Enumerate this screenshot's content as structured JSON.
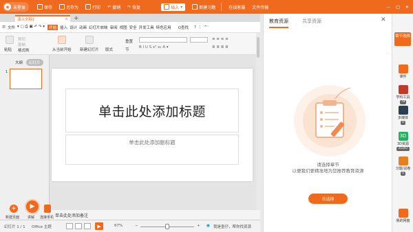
{
  "topbar": {
    "user_label": "未登录",
    "save": "保存",
    "save_as": "另存为",
    "print": "打印",
    "undo": "撤销",
    "redo": "恢复",
    "insert": "插入",
    "new_exercise": "新建习题",
    "online_service": "在线客服",
    "file_transfer": "文件传输"
  },
  "document_tab": {
    "title": "演示文稿1"
  },
  "menu": {
    "file": "文件",
    "items": [
      "开始",
      "插入",
      "设计",
      "动画",
      "幻灯片放映",
      "审阅",
      "视图",
      "安全",
      "开发工具",
      "特色应用"
    ],
    "search": "Q查找"
  },
  "ribbon": {
    "paste": "粘贴",
    "cut": "剪切",
    "copy": "复制",
    "format_painter": "格式刷",
    "play_from_current": "从当前开始",
    "new_slide": "新建幻灯片",
    "layout": "版式",
    "reset": "重置",
    "section": "节"
  },
  "left_pane": {
    "outline_tab": "大纲",
    "slide_tab": "幻灯片",
    "slide_number": "1"
  },
  "slide": {
    "title_placeholder": "单击此处添加标题",
    "subtitle_placeholder": "单击此处添加副标题"
  },
  "notes": {
    "placeholder": "单击此处添加备注"
  },
  "bottom_tools": {
    "new_page": "新建页面",
    "lecture": "讲解",
    "connect_phone": "连接手机"
  },
  "statusbar": {
    "slide_counter": "幻灯片 1 / 1",
    "theme": "Office 主题",
    "zoom": "67%",
    "assistant": "我是墨仔，帮你找资源"
  },
  "right_panel": {
    "tab_education": "教育资源",
    "tab_shared": "共享资源",
    "message_line1": "请选择章节",
    "message_line2": "以便我们更精准地为您推荐教育资源",
    "button": "去选择"
  },
  "sidebar": {
    "top_button": "章节选择",
    "items": [
      {
        "label": "课件",
        "badge": ""
      },
      {
        "label": "学科工具",
        "badge": "79"
      },
      {
        "label": "多媒体",
        "badge": "0"
      },
      {
        "label": "3D资源",
        "badge": "35397"
      },
      {
        "label": "习题/试卷",
        "badge": "0"
      }
    ],
    "my_resources": "我的网盘"
  },
  "colors": {
    "accent": "#f06a1e",
    "panel_bg": "#ffffff"
  }
}
